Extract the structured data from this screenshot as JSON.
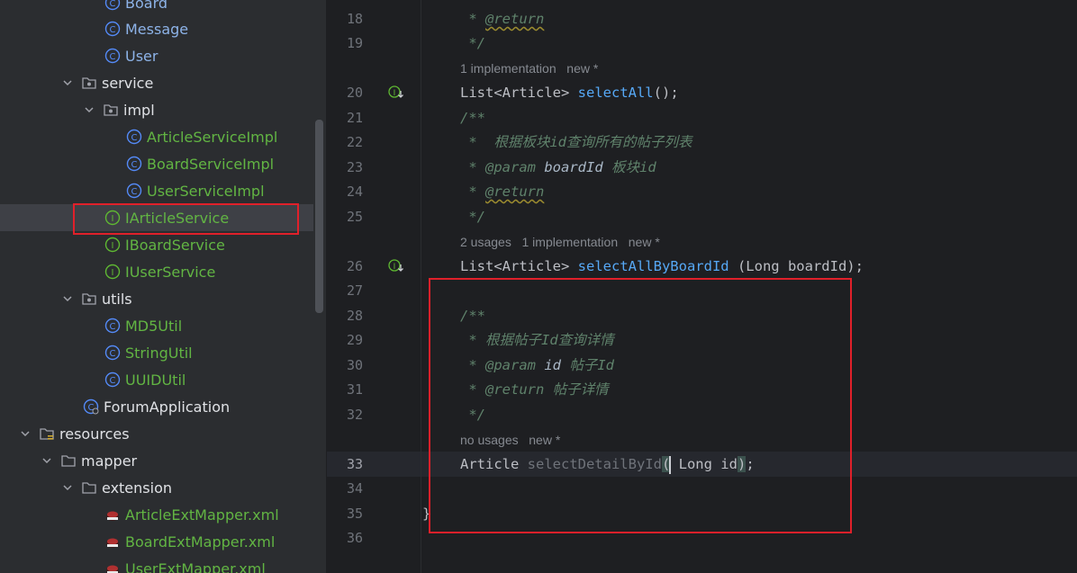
{
  "tree": {
    "items": [
      {
        "label": "Board",
        "icon": "class-icon"
      },
      {
        "label": "Message",
        "icon": "class-icon"
      },
      {
        "label": "User",
        "icon": "class-icon"
      },
      {
        "label": "service",
        "icon": "package-icon"
      },
      {
        "label": "impl",
        "icon": "package-icon"
      },
      {
        "label": "ArticleServiceImpl",
        "icon": "class-icon"
      },
      {
        "label": "BoardServiceImpl",
        "icon": "class-icon"
      },
      {
        "label": "UserServiceImpl",
        "icon": "class-icon"
      },
      {
        "label": "IArticleService",
        "icon": "interface-icon"
      },
      {
        "label": "IBoardService",
        "icon": "interface-icon"
      },
      {
        "label": "IUserService",
        "icon": "interface-icon"
      },
      {
        "label": "utils",
        "icon": "package-icon"
      },
      {
        "label": "MD5Util",
        "icon": "class-icon"
      },
      {
        "label": "StringUtil",
        "icon": "class-icon"
      },
      {
        "label": "UUIDUtil",
        "icon": "class-icon"
      },
      {
        "label": "ForumApplication",
        "icon": "spring-boot-class-icon"
      },
      {
        "label": "resources",
        "icon": "resources-folder-icon"
      },
      {
        "label": "mapper",
        "icon": "folder-icon"
      },
      {
        "label": "extension",
        "icon": "folder-icon"
      },
      {
        "label": "ArticleExtMapper.xml",
        "icon": "mybatis-xml-icon"
      },
      {
        "label": "BoardExtMapper.xml",
        "icon": "mybatis-xml-icon"
      },
      {
        "label": "UserExtMapper.xml",
        "icon": "mybatis-xml-icon"
      }
    ],
    "selected": "IArticleService"
  },
  "editor": {
    "line_numbers": [
      "18",
      "19",
      "20",
      "21",
      "22",
      "23",
      "24",
      "25",
      "26",
      "27",
      "28",
      "29",
      "30",
      "31",
      "32",
      "33",
      "34",
      "35",
      "36"
    ],
    "current_line": "33",
    "hints": {
      "h1": "1 implementation   new *",
      "h2": "2 usages   1 implementation   new *",
      "h3": "no usages   new *"
    },
    "code": {
      "l18_star": " * ",
      "l18_tag": "@return",
      "l19": " */",
      "l20_a": "List<Article> ",
      "l20_m": "selectAll",
      "l20_b": "();",
      "l21": "/**",
      "l22": " *  根据板块id查询所有的帖子列表",
      "l23_star": " * ",
      "l23_tag": "@param",
      "l23_p": " boardId",
      "l23_d": " 板块id",
      "l24_star": " * ",
      "l24_tag": "@return",
      "l25": " */",
      "l26_a": "List<Article> ",
      "l26_m": "selectAllByBoardId",
      "l26_b": " (Long boardId);",
      "l28": "/**",
      "l29": " * 根据帖子Id查询详情",
      "l30_star": " * ",
      "l30_tag": "@param",
      "l30_p": " id",
      "l30_d": " 帖子Id",
      "l31_star": " * ",
      "l31_tag": "@return",
      "l31_d": " 帖子详情",
      "l32": " */",
      "l33_a": "Article ",
      "l33_m": "selectDetailById",
      "l33_open": "(",
      "l33_b": " Long id",
      "l33_close": ")",
      "l33_c": ";",
      "l35": "}"
    }
  },
  "colors": {
    "highlight_box": "#e0202a",
    "class_icon": "#548af7",
    "interface_icon": "#5fb832",
    "comment": "#5f826b",
    "method": "#56a8f5"
  }
}
